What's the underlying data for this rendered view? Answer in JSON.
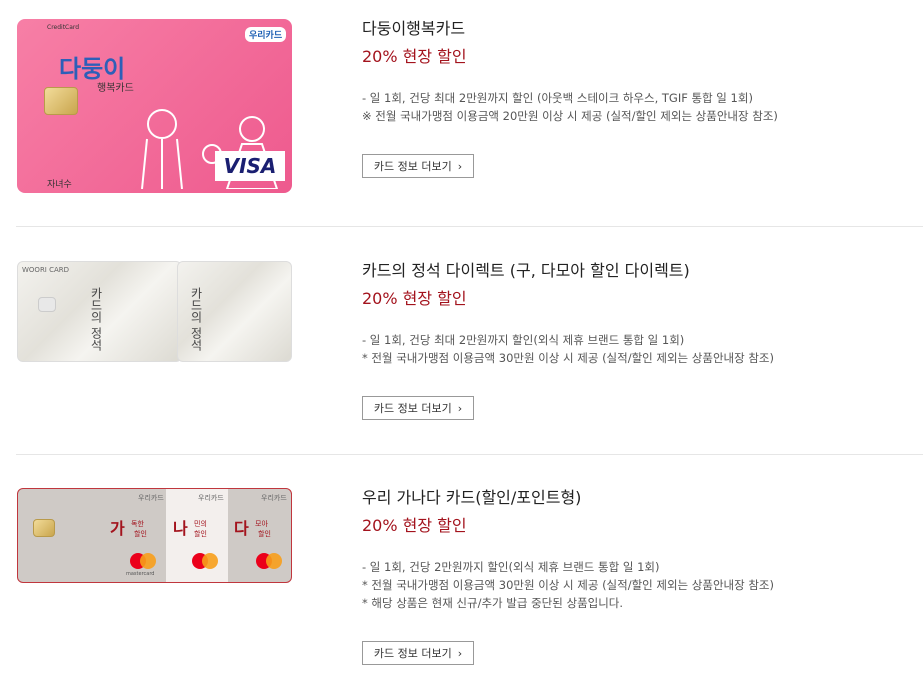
{
  "cards": [
    {
      "title": "다둥이행복카드",
      "discount": "20% 현장 할인",
      "desc": [
        "- 일 1회, 건당 최대 2만원까지 할인 (아웃백 스테이크 하우스, TGIF 통합 일 1회)",
        "※ 전월 국내가맹점 이용금액 20만원 이상 시 제공 (실적/할인 제외는 상품안내장 참조)"
      ],
      "button": "카드 정보 더보기",
      "art": {
        "card_label": "CreditCard",
        "name_big": "다둥이",
        "name_small": "행복카드",
        "bank": "우리카드",
        "brand": "VISA",
        "holder": "자녀수"
      }
    },
    {
      "title": "카드의 정석 다이렉트 (구, 다모아 할인 다이렉트)",
      "discount": "20% 현장 할인",
      "desc": [
        "- 일 1회, 건당 최대 2만원까지 할인(외식 제휴 브랜드 통합 일 1회)",
        "* 전월 국내가맹점 이용금액 30만원 이상 시 제공 (실적/할인 제외는 상품안내장 참조)"
      ],
      "button": "카드 정보 더보기",
      "art": {
        "card_label": "WOORI CARD",
        "name": "카드의 정석"
      }
    },
    {
      "title": "우리 가나다 카드(할인/포인트형)",
      "discount": "20% 현장 할인",
      "desc": [
        "- 일 1회, 건당 2만원까지 할인(외식 제휴 브랜드 통합 일 1회)",
        "* 전월 국내가맹점 이용금액 30만원 이상 시 제공 (실적/할인 제외는 상품안내장 참조)",
        "* 해당 상품은 현재 신규/추가 발급 중단된 상품입니다."
      ],
      "button": "카드 정보 더보기",
      "art": {
        "bank": "우리카드",
        "panels": [
          "가",
          "나",
          "다"
        ],
        "panel_sub": [
          "독한",
          "민의",
          "모아"
        ],
        "panel_word": "할인",
        "brand": "mastercard"
      }
    }
  ],
  "chevron": "›"
}
